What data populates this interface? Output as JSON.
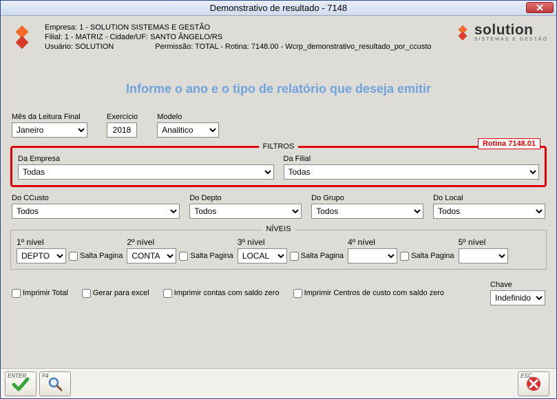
{
  "title": "Demonstrativo de resultado - 7148",
  "header": {
    "empresa": "Empresa: 1 - SOLUTION SISTEMAS E GESTÃO",
    "filial": "Filial: 1 - MATRIZ - Cidade/UF: SANTO ÂNGELO/RS",
    "usuario": "Usuário: SOLUTION",
    "permissao": "Permissão: TOTAL - Rotina: 7148.00 - Wcrp_demonstrativo_resultado_por_ccusto",
    "brand_main": "solution",
    "brand_sub": "SISTEMAS E GESTÃO"
  },
  "instruction": "Informe o ano e o tipo de relatório que deseja emitir",
  "top_fields": {
    "mes_label": "Mês da Leitura Final",
    "mes_value": "Janeiro",
    "exercicio_label": "Exercício",
    "exercicio_value": "2018",
    "modelo_label": "Modelo",
    "modelo_value": "Analitico"
  },
  "filtros": {
    "legend": "FILTROS",
    "routine_badge": "Rotina 7148.01",
    "empresa_label": "Da Empresa",
    "empresa_value": "Todas",
    "filial_label": "Da Filial",
    "filial_value": "Todas"
  },
  "filtros2": {
    "ccusto_label": "Do CCusto",
    "ccusto_value": "Todos",
    "depto_label": "Do Depto",
    "depto_value": "Todos",
    "grupo_label": "Do Grupo",
    "grupo_value": "Todos",
    "local_label": "Do Local",
    "local_value": "Todos"
  },
  "niveis": {
    "legend": "NÍVEIS",
    "salta": "Salta Pagina",
    "n1_label": "1º nível",
    "n1_value": "DEPTO",
    "n2_label": "2º nível",
    "n2_value": "CONTA",
    "n3_label": "3º nível",
    "n3_value": "LOCAL",
    "n4_label": "4º nível",
    "n4_value": "",
    "n5_label": "5º nível",
    "n5_value": ""
  },
  "options": {
    "imprimir_total": "Imprimir Total",
    "gerar_excel": "Gerar para excel",
    "contas_zero": "Imprimir contas com saldo zero",
    "cc_zero": "Imprimir Centros de custo com saldo zero",
    "chave_label": "Chave",
    "chave_value": "Indefinido"
  },
  "buttons": {
    "enter": "ENTER",
    "f4": "F4",
    "esc": "ESC"
  }
}
